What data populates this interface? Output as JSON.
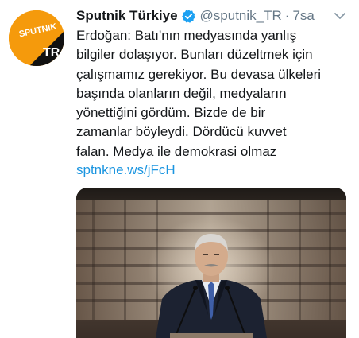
{
  "tweet": {
    "display_name": "Sputnik Türkiye",
    "handle": "@sputnik_TR",
    "separator": "·",
    "time": "7sa",
    "lines": [
      "Erdoğan: Batı'nın medyasında yanlış",
      "bilgiler dolaşıyor. Bunları düzeltmek için",
      "çalışmamız gerekiyor. Bu devasa ülkeleri",
      "başında olanların değil, medyaların",
      "yönettiğini gördüm. Bizde de bir",
      "zamanlar böyleydi. Dördücü kuvvet",
      "falan. Medya ile demokrasi olmaz"
    ],
    "link": "sptnkne.ws/jFcH"
  },
  "avatar": {
    "logo_text": "SPUTNIK",
    "badge_text": "TR",
    "colors": {
      "orange": "#f59a0c",
      "black": "#111111",
      "white": "#ffffff"
    }
  },
  "icons": {
    "verified": "verified-badge-icon",
    "menu": "chevron-down-icon"
  },
  "colors": {
    "text": "#14171a",
    "secondary": "#657786",
    "link": "#1b95e0",
    "verified": "#1da1f2"
  }
}
